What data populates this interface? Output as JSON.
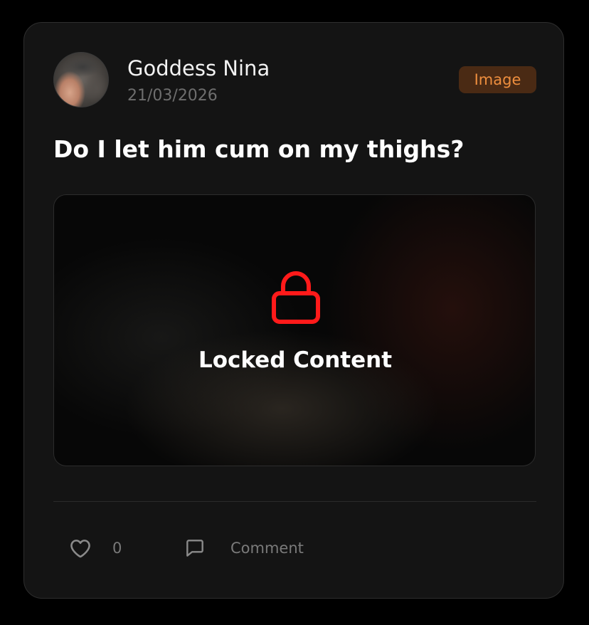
{
  "post": {
    "author": "Goddess Nina",
    "date": "21/03/2026",
    "badge": "Image",
    "title": "Do I let him cum on my thighs?",
    "locked_label": "Locked Content",
    "likes": "0",
    "comment_label": "Comment"
  },
  "colors": {
    "accent": "#ee8e3e",
    "badge_bg": "#4a2a14",
    "lock": "#ff1a1a",
    "card_bg": "#141414"
  },
  "icons": {
    "lock": "lock-icon",
    "like": "heart-icon",
    "comment": "comment-icon"
  }
}
